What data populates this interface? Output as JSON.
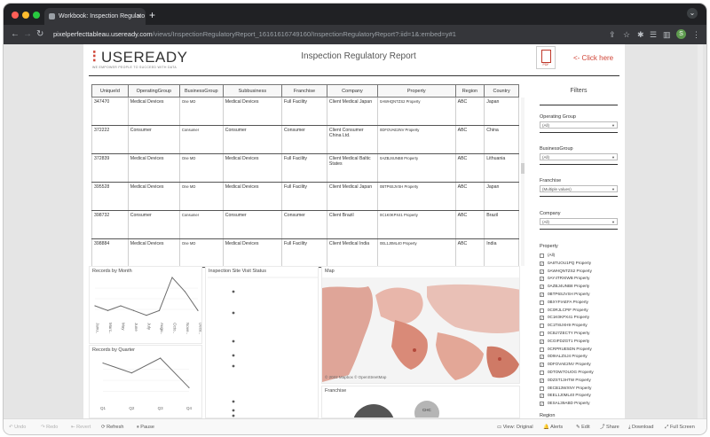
{
  "browser": {
    "tab_title": "Workbook: Inspection Regulato",
    "tab_close": "×",
    "new_tab": "+",
    "menu": "⌄",
    "url_host": "pixelperfecttableau.useready.com",
    "url_path": "/views/InspectionRegulatoryReport_16161616749160/InspectionRegulatoryReport?:iid=1&:embed=y#1",
    "avatar": "S",
    "colors": {
      "red": "#ff5f57",
      "yellow": "#febc2e",
      "green": "#28c840"
    }
  },
  "header": {
    "logo": "USEREADY",
    "logo_tag": "WE EMPOWER PEOPLE TO SUCCEED WITH DATA",
    "title": "Inspection Regulatory Report",
    "pdf_label": "PDF",
    "click_here": "<- Click here"
  },
  "table": {
    "columns": [
      "UniqueId",
      "OperatingGroup",
      "BusinessGroup",
      "Subbusiness",
      "Franchise",
      "Company",
      "Property",
      "Region",
      "Country"
    ],
    "rows": [
      [
        "347470",
        "Medical Devices",
        "One MD",
        "Medical Devices",
        "Full Facility",
        "Client Medical Japan",
        "0AWHQNTZS2 Property",
        "ABC",
        "Japan"
      ],
      [
        "372222",
        "Consumer",
        "Consumer",
        "Consumer",
        "Consumer",
        "Client Consumer China Ltd.",
        "0DFOVAE2NV Property",
        "ABC",
        "China"
      ],
      [
        "372839",
        "Medical Devices",
        "One MD",
        "Medical Devices",
        "Full Facility",
        "Client Medical Baltic States",
        "0AZBJ4UNB8 Property",
        "ABC",
        "Lithuania"
      ],
      [
        "395528",
        "Medical Devices",
        "One MD",
        "Medical Devices",
        "Full Facility",
        "Client Medical Japan",
        "0BTP6SJVSH Property",
        "ABC",
        "Japan"
      ],
      [
        "398732",
        "Consumer",
        "Consumer",
        "Consumer",
        "Consumer",
        "Client Brazil",
        "0C1K0KPX41 Property",
        "ABC",
        "Brazil"
      ],
      [
        "398884",
        "Medical Devices",
        "One MD",
        "Medical Devices",
        "Full Facility",
        "Client Medical India",
        "0EL1J0ML40 Property",
        "ABC",
        "India"
      ]
    ]
  },
  "panels": {
    "records_month": "Records by Month",
    "records_quarter": "Records by Quarter",
    "site_visit": "Inspection Site Visit Status",
    "map": "Map",
    "map_credit": "© 2022 Mapbox  © OpenStreetMap",
    "franchise": "Franchise",
    "franchise_bubble": "CHC"
  },
  "chart_data": [
    {
      "type": "line",
      "title": "Records by Month",
      "categories": [
        "Janu..",
        "Marc..",
        "May",
        "June",
        "July",
        "Augu..",
        "Octo..",
        "Nove..",
        "Dece.."
      ],
      "values": [
        3,
        2,
        3,
        2,
        1,
        2,
        9,
        6,
        2
      ]
    },
    {
      "type": "line",
      "title": "Records by Quarter",
      "categories": [
        "Q1",
        "Q2",
        "Q3",
        "Q4"
      ],
      "values": [
        8,
        6,
        9,
        3
      ]
    },
    {
      "type": "scatter",
      "title": "Inspection Site Visit Status",
      "y": [
        1,
        2,
        3,
        4,
        5,
        6,
        7,
        8,
        9,
        10,
        11
      ]
    }
  ],
  "filters": {
    "title": "Filters",
    "dropdowns": [
      {
        "label": "Operating Group",
        "value": "(All)"
      },
      {
        "label": "BusinessGroup",
        "value": "(All)"
      },
      {
        "label": "Franchise",
        "value": "(Multiple values)"
      },
      {
        "label": "Company",
        "value": "(All)"
      }
    ],
    "property_label": "Property",
    "properties": [
      {
        "name": "(All)",
        "checked": false
      },
      {
        "name": "0A6TUOU1PQ Property",
        "checked": true
      },
      {
        "name": "0AWHQNTZS2 Property",
        "checked": true
      },
      {
        "name": "0AY4TRXIWB Property",
        "checked": true
      },
      {
        "name": "0AZBJ4UNB8 Property",
        "checked": true
      },
      {
        "name": "0BTP6SJVSH Property",
        "checked": true
      },
      {
        "name": "0BXYFIAEFA Property",
        "checked": false
      },
      {
        "name": "0C0RJLCPIF Property",
        "checked": false
      },
      {
        "name": "0C1K0KPX41 Property",
        "checked": true
      },
      {
        "name": "0C1T8UXH9 Property",
        "checked": false
      },
      {
        "name": "0CBJ7ZECTY Property",
        "checked": false
      },
      {
        "name": "0CGIFDZGT1 Property",
        "checked": true
      },
      {
        "name": "0CRPRUE5DN Property",
        "checked": false
      },
      {
        "name": "0D9IALZSJ4 Property",
        "checked": true
      },
      {
        "name": "0DFOVAE2NV Property",
        "checked": true
      },
      {
        "name": "0DTOW7OUOG Property",
        "checked": false
      },
      {
        "name": "0DZST13HTW Property",
        "checked": true
      },
      {
        "name": "0ECB13WXNY Property",
        "checked": false
      },
      {
        "name": "0EEL1J0ML40 Property",
        "checked": true
      },
      {
        "name": "0ESAL39ABD Property",
        "checked": true
      }
    ],
    "region_label": "Region"
  },
  "statusbar": {
    "undo": "Undo",
    "redo": "Redo",
    "revert": "Revert",
    "refresh": "Refresh",
    "pause": "Pause",
    "view": "View: Original",
    "alerts": "Alerts",
    "edit": "Edit",
    "share": "Share",
    "download": "Download",
    "fullscreen": "Full Screen"
  }
}
